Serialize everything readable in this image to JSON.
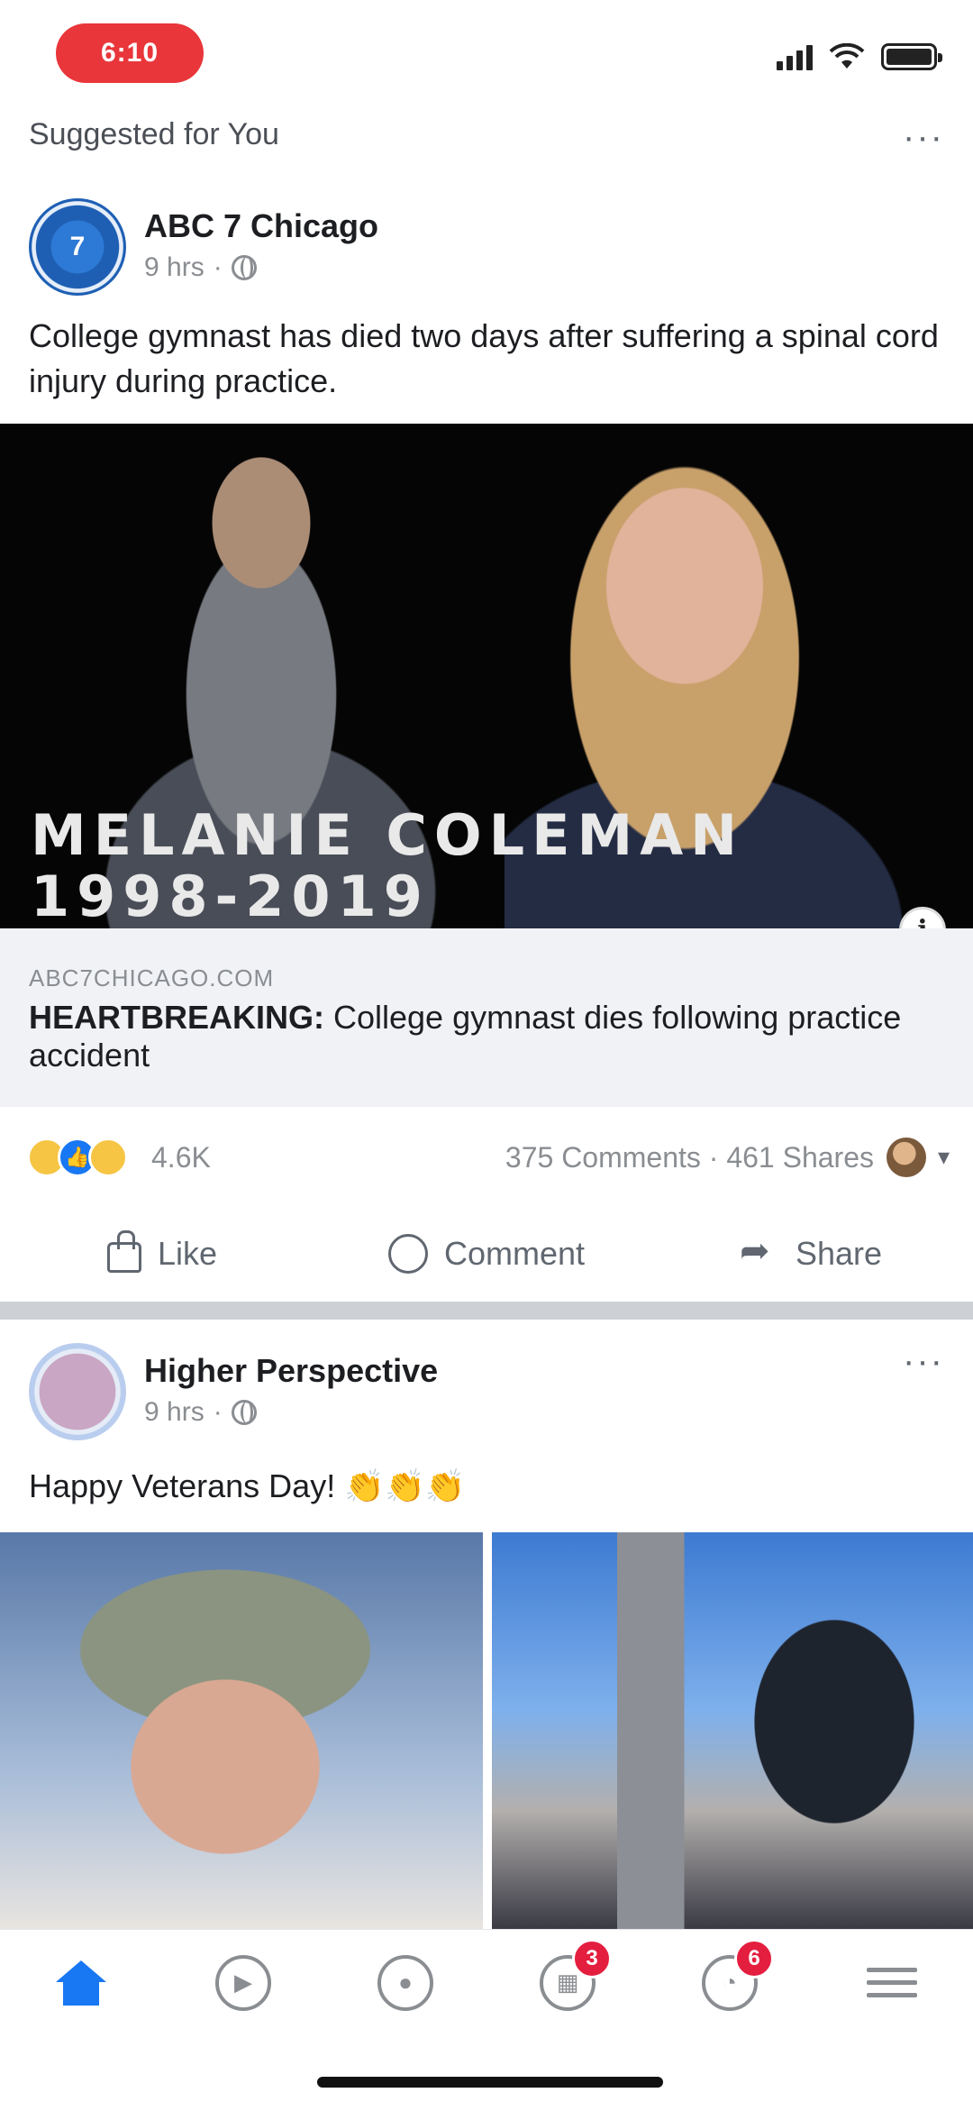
{
  "status_bar": {
    "time": "6:10"
  },
  "feed_section": {
    "title": "Suggested for You",
    "more": "···"
  },
  "post1": {
    "page_name": "ABC 7 Chicago",
    "time": "9 hrs",
    "more": "···",
    "text": "College gymnast has died two days after suffering a spinal cord injury during practice.",
    "image_caption_line1": "MELANIE COLEMAN",
    "image_caption_line2": "1998-2019",
    "link": {
      "domain": "ABC7CHICAGO.COM",
      "title_strong": "HEARTBREAKING:",
      "title_rest": " College gymnast dies following practice accident"
    },
    "reactions": {
      "count": "4.6K",
      "comments": "375 Comments",
      "shares": "461 Shares"
    },
    "actions": {
      "like": "Like",
      "comment": "Comment",
      "share": "Share"
    }
  },
  "post2": {
    "page_name": "Higher Perspective",
    "time": "9 hrs",
    "more": "···",
    "text": "Happy Veterans Day! 👏👏👏"
  },
  "tab_bar": {
    "badges": {
      "marketplace": "3",
      "notifications": "6"
    }
  },
  "colors": {
    "accent": "#1877f2",
    "badge": "#e41e3f",
    "time_pill": "#e8363b"
  },
  "icons": [
    "home-icon",
    "watch-icon",
    "groups-icon",
    "marketplace-icon",
    "notifications-icon",
    "menu-icon"
  ]
}
